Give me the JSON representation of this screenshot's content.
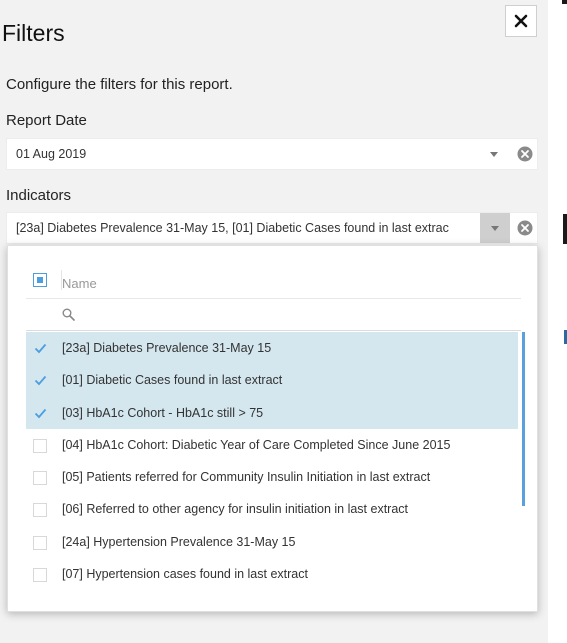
{
  "panel": {
    "title": "Filters",
    "description": "Configure the filters for this report."
  },
  "report_date": {
    "label": "Report Date",
    "value": "01 Aug 2019"
  },
  "indicators": {
    "label": "Indicators",
    "value": "[23a] Diabetes Prevalence 31-May 15, [01] Diabetic Cases found in last extrac",
    "list_header": "Name",
    "search_value": "",
    "items": [
      {
        "label": "[23a] Diabetes Prevalence 31-May 15",
        "checked": true
      },
      {
        "label": "[01] Diabetic Cases found in last extract",
        "checked": true
      },
      {
        "label": "[03] HbA1c Cohort - HbA1c still > 75",
        "checked": true
      },
      {
        "label": "[04] HbA1c Cohort: Diabetic Year of Care Completed Since June 2015",
        "checked": false
      },
      {
        "label": "[05] Patients referred for Community Insulin Initiation in last extract",
        "checked": false
      },
      {
        "label": "[06] Referred to other agency for insulin initiation in last extract",
        "checked": false
      },
      {
        "label": "[24a] Hypertension Prevalence 31-May 15",
        "checked": false
      },
      {
        "label": "[07] Hypertension cases found in last extract",
        "checked": false
      }
    ]
  },
  "icons": {
    "close": "close-icon",
    "clear": "clear-icon",
    "dropdown": "chevron-down-icon",
    "search": "search-icon",
    "check": "check-icon"
  },
  "colors": {
    "selected_row": "#d4e6ee",
    "accent": "#4a9fe0",
    "scrollbar": "#5aa0dd"
  }
}
